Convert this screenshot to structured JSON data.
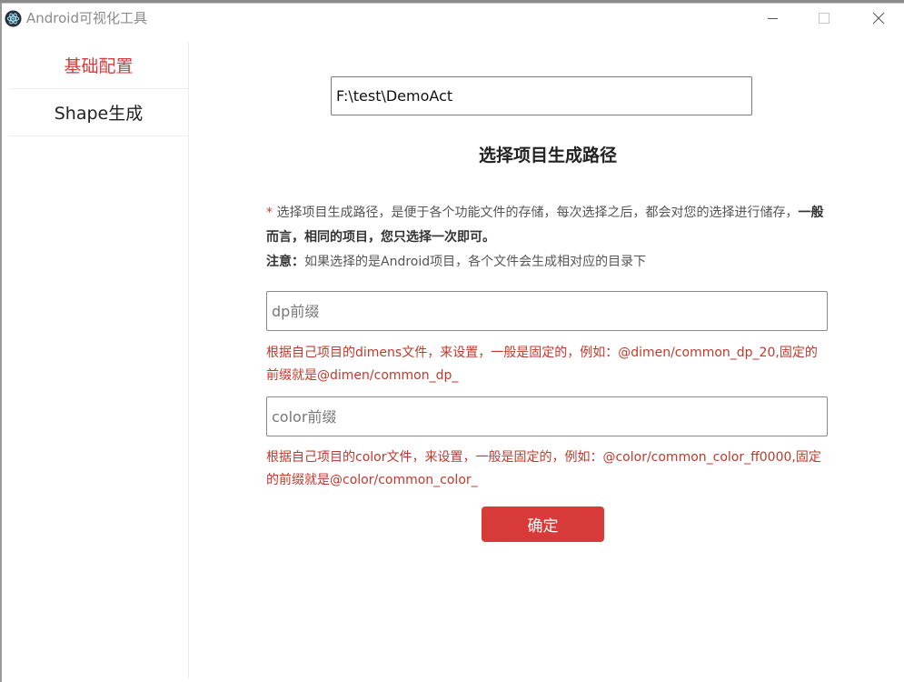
{
  "window": {
    "title": "Android可视化工具"
  },
  "sidebar": {
    "items": [
      {
        "label": "基础配置",
        "active": true
      },
      {
        "label": "Shape生成",
        "active": false
      }
    ]
  },
  "main": {
    "path_value": "F:\\test\\DemoAct",
    "title": "选择项目生成路径",
    "desc": {
      "star": "*",
      "line1_a": " 选择项目生成路径，是便于各个功能文件的存储，每次选择之后，都会对您的选择进行储存，",
      "line1_b": "一般而言，相同的项目，您只选择一次即可。",
      "note_label": "注意：",
      "note_text": "如果选择的是Android项目，各个文件会生成相对应的目录下"
    },
    "dp_placeholder": "dp前缀",
    "dp_hint": "根据自己项目的dimens文件，来设置，一般是固定的，例如：@dimen/common_dp_20,固定的前缀就是@dimen/common_dp_",
    "color_placeholder": "color前缀",
    "color_hint": "根据自己项目的color文件，来设置，一般是固定的，例如：@color/common_color_ff0000,固定的前缀就是@color/common_color_",
    "confirm_label": "确定"
  },
  "colors": {
    "accent": "#d83a3a",
    "hint": "#c0392b"
  }
}
